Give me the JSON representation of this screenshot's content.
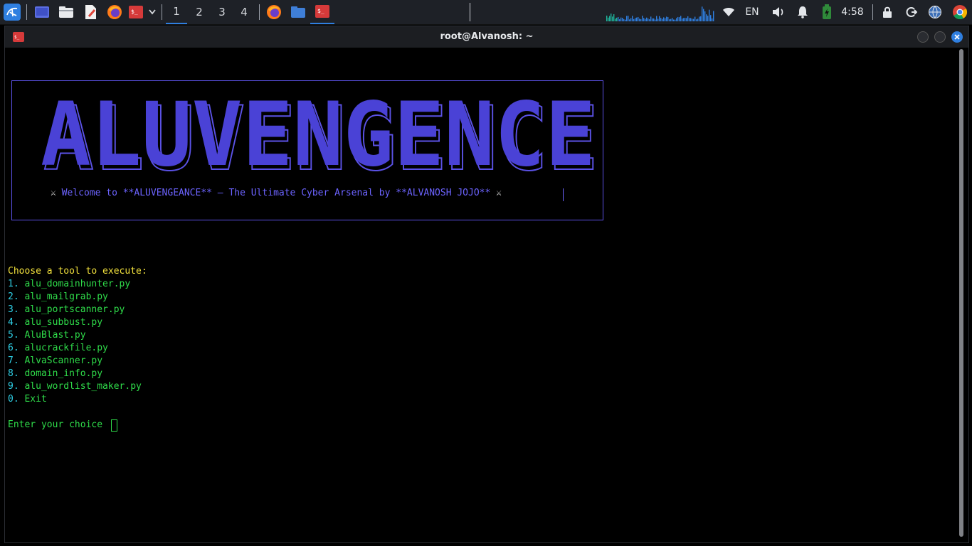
{
  "taskbar": {
    "workspaces": [
      "1",
      "2",
      "3",
      "4"
    ],
    "active_workspace": "1",
    "language": "EN",
    "clock": "4:58"
  },
  "window": {
    "title": "root@Alvanosh: ~"
  },
  "terminal": {
    "banner_text": "ALUVENGENCE",
    "welcome_message": "Welcome to **ALUVENGEANCE** – The Ultimate Cyber Arsenal by **ALVANOSH JOJO**",
    "swords_glyph": "⚔",
    "menu_prompt": "Choose a tool to execute:",
    "menu_items": [
      {
        "number": "1.",
        "label": "alu_domainhunter.py"
      },
      {
        "number": "2.",
        "label": "alu_mailgrab.py"
      },
      {
        "number": "3.",
        "label": "alu_portscanner.py"
      },
      {
        "number": "4.",
        "label": "alu_subbust.py"
      },
      {
        "number": "5.",
        "label": "AluBlast.py"
      },
      {
        "number": "6.",
        "label": "alucrackfile.py"
      },
      {
        "number": "7.",
        "label": "AlvaScanner.py"
      },
      {
        "number": "8.",
        "label": "domain_info.py"
      },
      {
        "number": "9.",
        "label": "alu_wordlist_maker.py"
      },
      {
        "number": "0.",
        "label": "Exit"
      }
    ],
    "input_prompt": "Enter your choice",
    "input_value": ""
  },
  "colors": {
    "banner_blue": "#4a42d6",
    "prompt_yellow": "#f1e03c",
    "number_cyan": "#2fd0e6",
    "item_green": "#2fdc4a",
    "taskbar_bg": "#1e2127",
    "accent_blue": "#2f7fe0"
  }
}
